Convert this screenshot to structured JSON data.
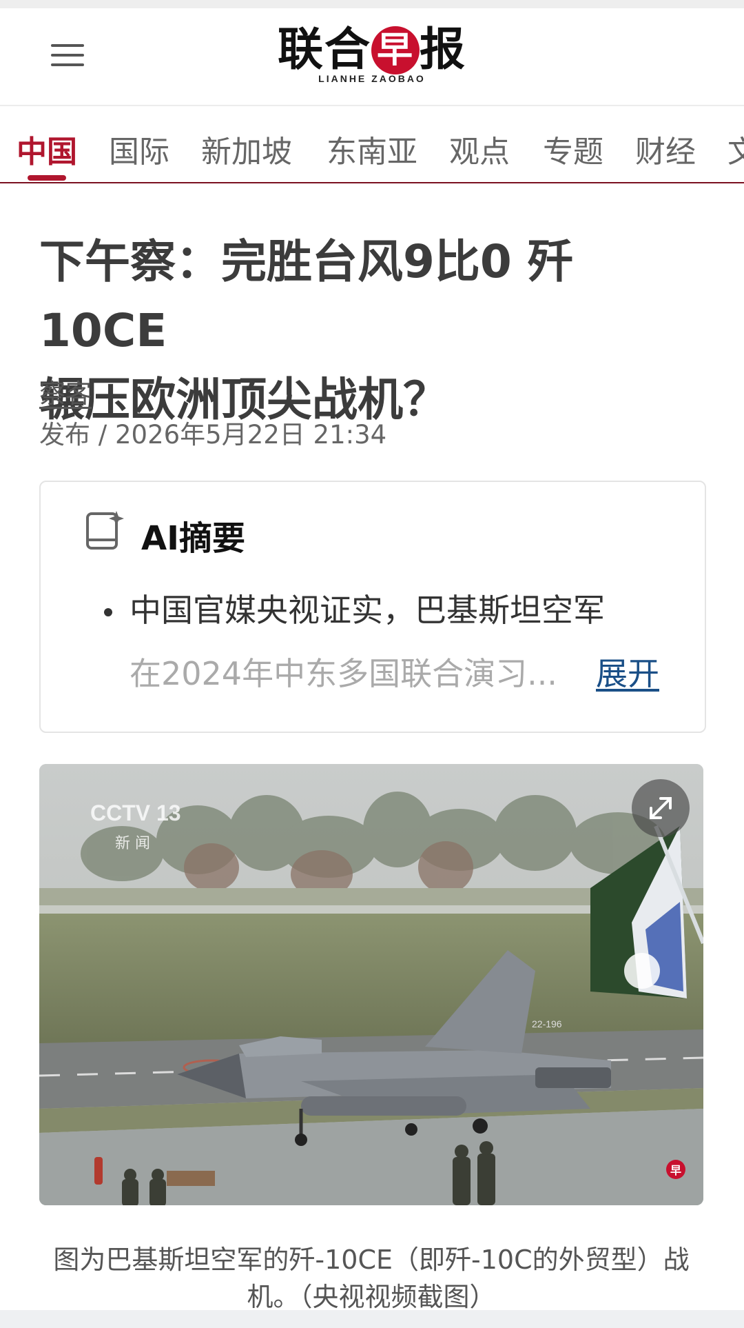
{
  "masthead": {
    "logo_cn_part1": "联合",
    "logo_cn_red": "早",
    "logo_cn_part2": "报",
    "logo_en": "LIANHE ZAOBAO",
    "menu_icon": "hamburger-icon"
  },
  "tabs": [
    {
      "label": "中国",
      "active": true
    },
    {
      "label": "国际"
    },
    {
      "label": "新加坡"
    },
    {
      "label": "东南亚"
    },
    {
      "label": "观点"
    },
    {
      "label": "专题"
    },
    {
      "label": "财经"
    },
    {
      "label": "文"
    }
  ],
  "article": {
    "headline_line1": "下午察：完胜台风9比0 歼10CE",
    "headline_line2": "辗压欧洲顶尖战机？",
    "author": "察客",
    "published": "发布 / 2026年5月22日 21:34"
  },
  "ai_summary": {
    "title": "AI摘要",
    "icon": "ai-summary-book-icon",
    "line1": "中国官媒央视证实，巴基斯坦空军",
    "line2": "在2024年中东多国联合演习...",
    "expand": "展开"
  },
  "photo": {
    "watermark_channel": "CCTV 13",
    "watermark_sub": "新 闻",
    "tail_number": "22-196",
    "expand_icon": "expand-arrows-icon",
    "corner_logo": "早",
    "caption_line1": "图为巴基斯坦空军的歼-10CE（即歼-10C的外贸型）战",
    "caption_line2": "机。（央视视频截图）"
  },
  "colors": {
    "accent": "#b0162e",
    "link": "#1a4f87",
    "logo_red": "#c8102e"
  }
}
